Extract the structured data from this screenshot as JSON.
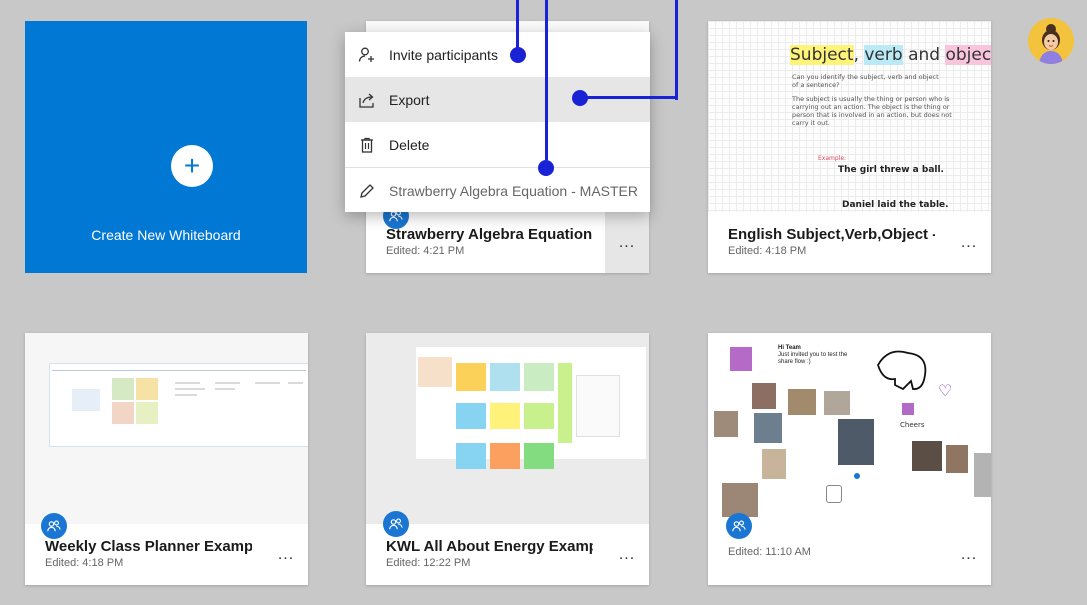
{
  "create": {
    "label": "Create New Whiteboard",
    "plus": "+"
  },
  "menu": {
    "invite": "Invite participants",
    "export": "Export",
    "delete": "Delete",
    "rename": "Strawberry Algebra Equation - MASTER"
  },
  "cards": [
    {
      "title": "Strawberry Algebra Equation -...",
      "edited": "Edited: 4:21 PM"
    },
    {
      "title": "English Subject,Verb,Object - M...",
      "edited": "Edited: 4:18 PM"
    },
    {
      "title": "Weekly Class Planner Example",
      "edited": "Edited: 4:18 PM"
    },
    {
      "title": "KWL All About Energy Example",
      "edited": "Edited: 12:22 PM"
    },
    {
      "title": "",
      "edited": "Edited: 11:10 AM"
    }
  ],
  "more_label": "...",
  "english_preview": {
    "heading_subject": "Subject",
    "heading_comma": ",",
    "heading_verb": "verb",
    "heading_and": "and",
    "heading_object": "object",
    "line1": "Can you identify the subject, verb and object",
    "line2": "of a sentence?",
    "line3": "The subject is usually the thing or person who is",
    "line4": "carrying out an action. The object is the thing or",
    "line5": "person that is involved in an action, but does not",
    "line6": "carry it out.",
    "example_label": "Example:",
    "example": "The girl threw a ball.",
    "example2": "Daniel laid the table."
  },
  "team_preview": {
    "title": "Hi Team",
    "line1": "Just invited you to test the",
    "line2": "share flow :)",
    "sign": "Cheers"
  },
  "colors": {
    "accent": "#0078d4",
    "annotation": "#1a22d6",
    "background": "#c8c8c8"
  }
}
